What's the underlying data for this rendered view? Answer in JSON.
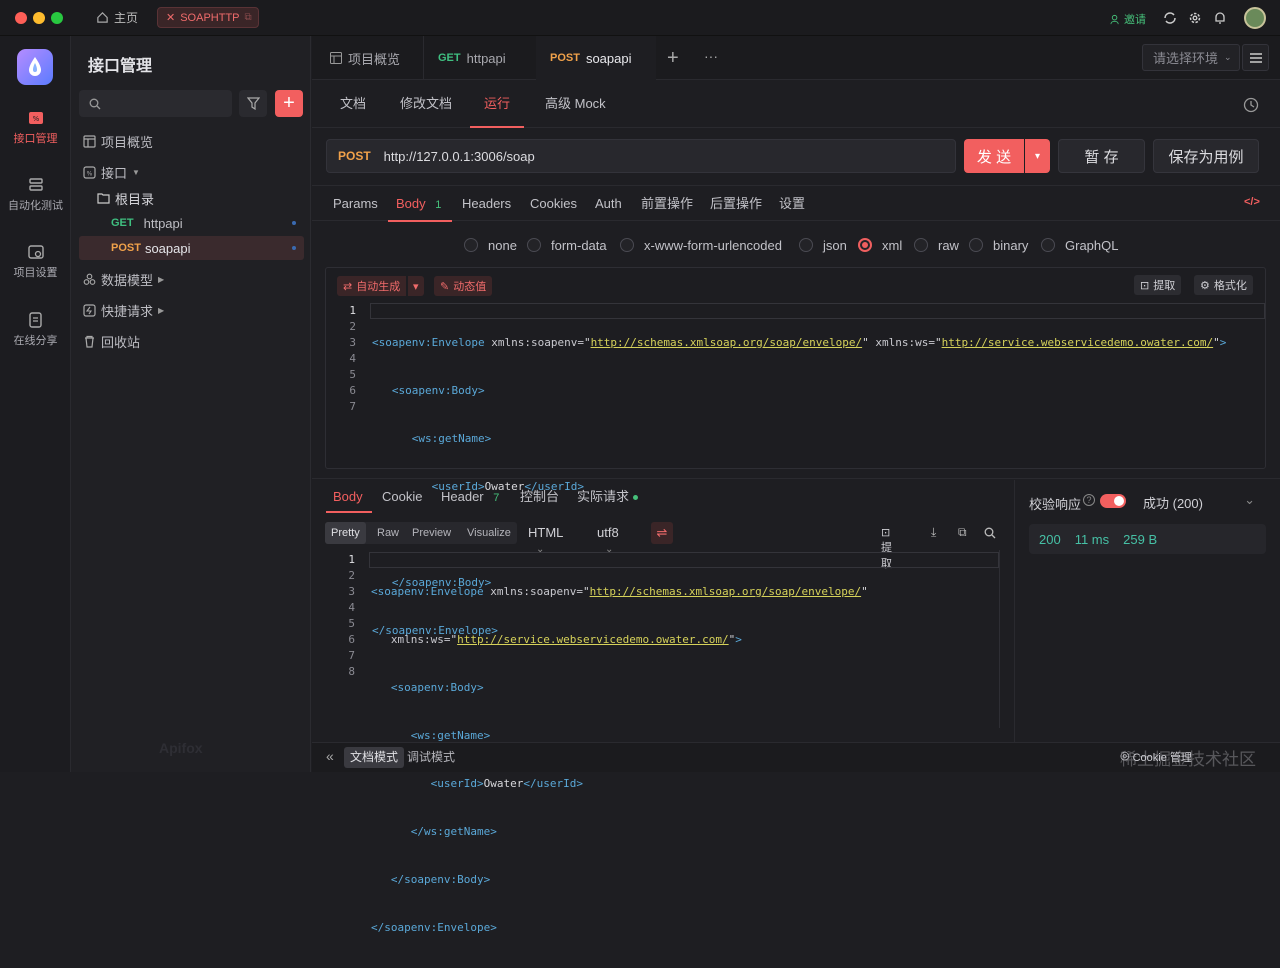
{
  "titlebar": {
    "home_label": "主页",
    "project_tab": "SOAPHTTP",
    "invite_label": "邀请"
  },
  "rail": {
    "items": [
      {
        "label": "接口管理",
        "icon": "api-icon",
        "active": true
      },
      {
        "label": "自动化测试",
        "icon": "automation-icon",
        "active": false
      },
      {
        "label": "项目设置",
        "icon": "settings-icon",
        "active": false
      },
      {
        "label": "在线分享",
        "icon": "share-icon",
        "active": false
      }
    ]
  },
  "sidenav": {
    "title": "接口管理",
    "search_placeholder": "",
    "tree": {
      "overview": "项目概览",
      "api": "接口",
      "root": "根目录",
      "httpapi_method": "GET",
      "httpapi_name": "httpapi",
      "soapapi_method": "POST",
      "soapapi_name": "soapapi",
      "models": "数据模型",
      "quick": "快捷请求",
      "trash": "回收站"
    },
    "footer_logo": "Apifox"
  },
  "tabs": {
    "overview": "项目概览",
    "tab1_method": "GET",
    "tab1_name": "httpapi",
    "tab2_method": "POST",
    "tab2_name": "soapapi",
    "env_placeholder": "请选择环境"
  },
  "subtabs": {
    "doc": "文档",
    "edit": "修改文档",
    "run": "运行",
    "mock": "高级 Mock"
  },
  "request": {
    "method": "POST",
    "url": "http://127.0.0.1:3006/soap",
    "send": "发 送",
    "save_temp": "暂 存",
    "save_case": "保存为用例"
  },
  "reqtabs": {
    "params": "Params",
    "body": "Body",
    "body_count": "1",
    "headers": "Headers",
    "cookies": "Cookies",
    "auth": "Auth",
    "pre": "前置操作",
    "post": "后置操作",
    "settings": "设置"
  },
  "body_types": [
    "none",
    "form-data",
    "x-www-form-urlencoded",
    "json",
    "xml",
    "raw",
    "binary",
    "GraphQL"
  ],
  "body_selected": "xml",
  "editor1": {
    "auto_gen": "自动生成",
    "dynamic": "动态值",
    "extract": "提取",
    "format": "格式化",
    "line_numbers": [
      "1",
      "2",
      "3",
      "4",
      "5",
      "6",
      "7"
    ]
  },
  "request_xml": {
    "env_open": "soapenv:Envelope",
    "attr1": "xmlns:soapenv",
    "val1": "http://schemas.xmlsoap.org/soap/envelope/",
    "attr2": "xmlns:ws",
    "val2": "http://service.webservicedemo.owater.com/",
    "body_tag": "soapenv:Body",
    "get_name": "ws:getName",
    "user_id": "userId",
    "user_value": "Owater"
  },
  "response": {
    "tabs": {
      "body": "Body",
      "cookie": "Cookie",
      "header": "Header",
      "header_count": "7",
      "console": "控制台",
      "actual": "实际请求"
    },
    "view": {
      "pretty": "Pretty",
      "raw": "Raw",
      "preview": "Preview",
      "visualize": "Visualize",
      "format": "HTML",
      "encoding": "utf8",
      "extract": "提取"
    },
    "line_numbers": [
      "1",
      "2",
      "3",
      "4",
      "5",
      "6",
      "7",
      "8"
    ],
    "validate_label": "校验响应",
    "status_label": "成功 (200)",
    "code": "200",
    "time": "11 ms",
    "size": "259 B"
  },
  "bottombar": {
    "doc_mode": "文档模式",
    "debug_mode": "调试模式",
    "cookie_manager": "Cookie 管理",
    "watermark": "稀土掘金技术社区"
  },
  "colors": {
    "accent": "#f25f5f",
    "get": "#3fbf80",
    "post": "#f0a14a",
    "success": "#46c07a"
  }
}
